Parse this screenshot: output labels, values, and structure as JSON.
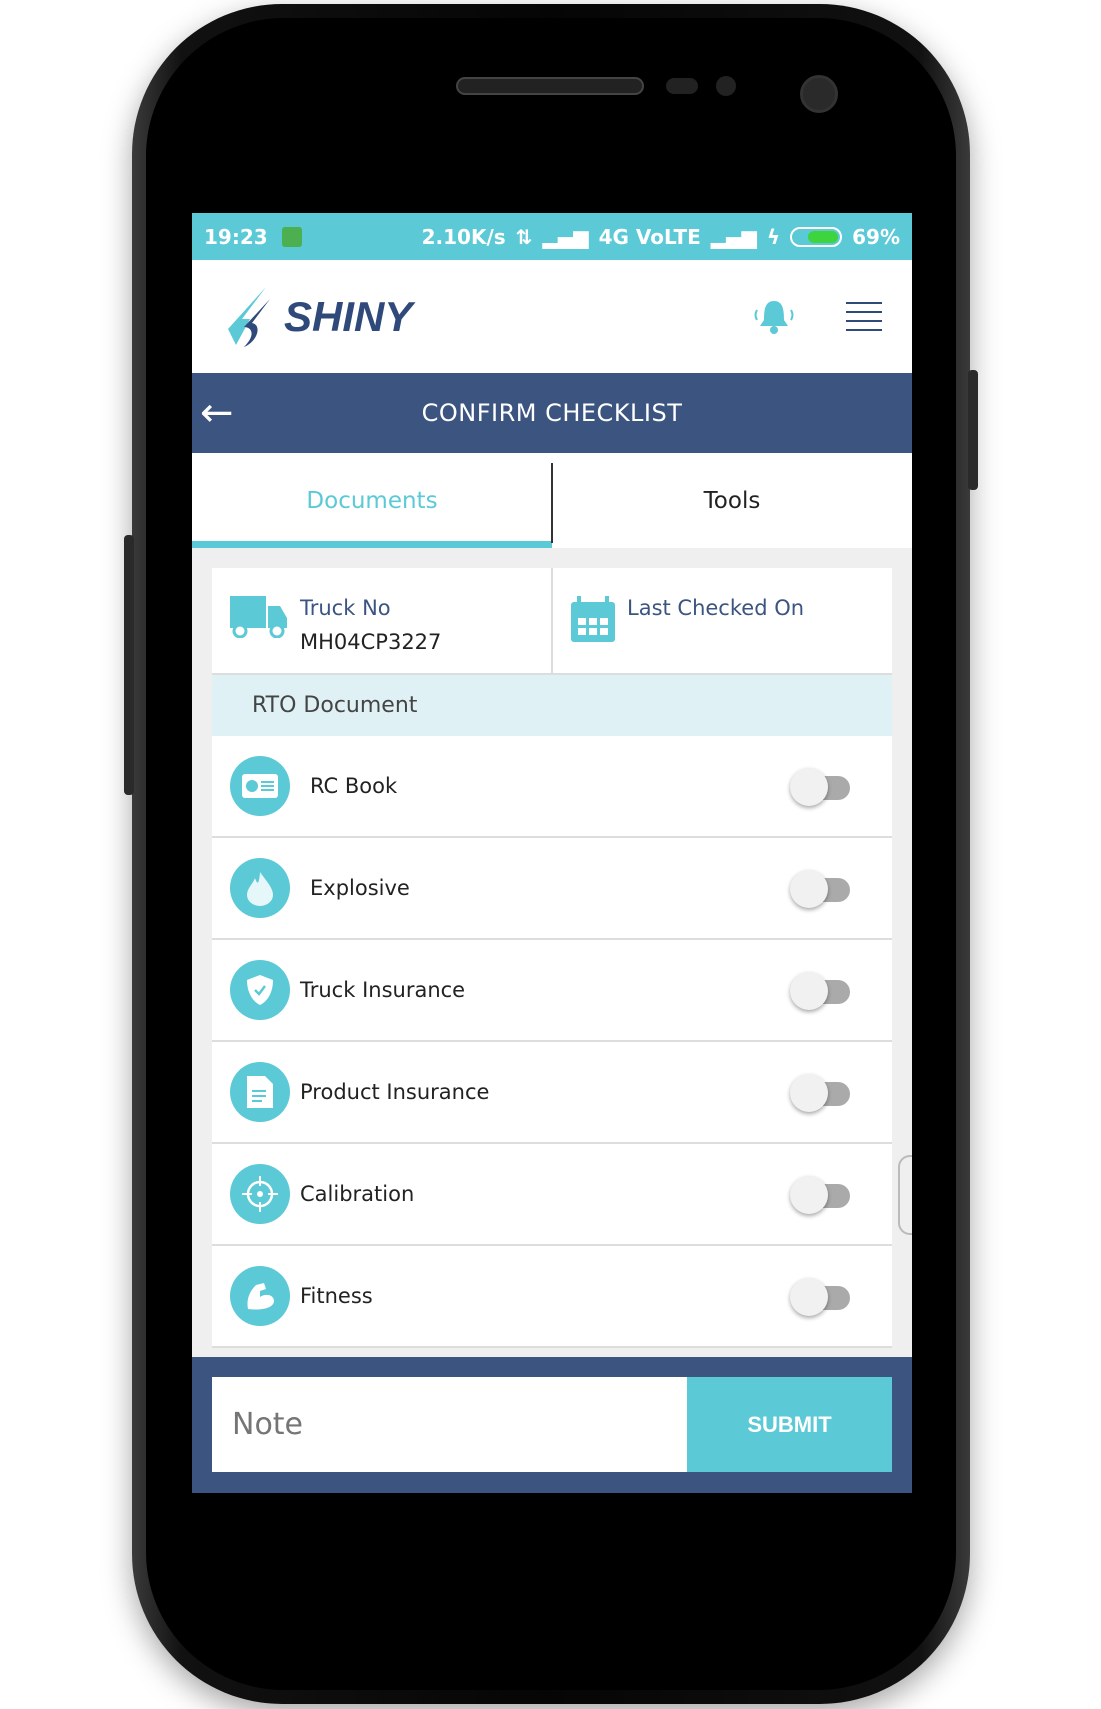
{
  "status_bar": {
    "time": "19:23",
    "speed": "2.10K/s",
    "network": "4G VoLTE",
    "battery": "69%",
    "battery_level": 0.69
  },
  "header": {
    "logo_text": "SHINY",
    "bell_icon": "bell-icon",
    "menu_icon": "hamburger-icon"
  },
  "titlebar": {
    "title": "CONFIRM CHECKLIST"
  },
  "tabs": [
    {
      "label": "Documents",
      "active": true
    },
    {
      "label": "Tools",
      "active": false
    }
  ],
  "info": {
    "truck_label": "Truck No",
    "truck_value": "MH04CP3227",
    "last_checked_label": "Last Checked On"
  },
  "section": {
    "title": "RTO Document"
  },
  "items": [
    {
      "label": "RC Book",
      "checked": false
    },
    {
      "label": "Explosive",
      "checked": false
    },
    {
      "label": "Truck Insurance",
      "checked": false
    },
    {
      "label": "Product Insurance",
      "checked": false
    },
    {
      "label": "Calibration",
      "checked": false
    },
    {
      "label": "Fitness",
      "checked": false
    }
  ],
  "footer": {
    "note_placeholder": "Note",
    "submit_label": "SUBMIT"
  },
  "colors": {
    "accent": "#5bc9d6",
    "primary": "#3c5480",
    "section_bg": "#dff1f5"
  }
}
